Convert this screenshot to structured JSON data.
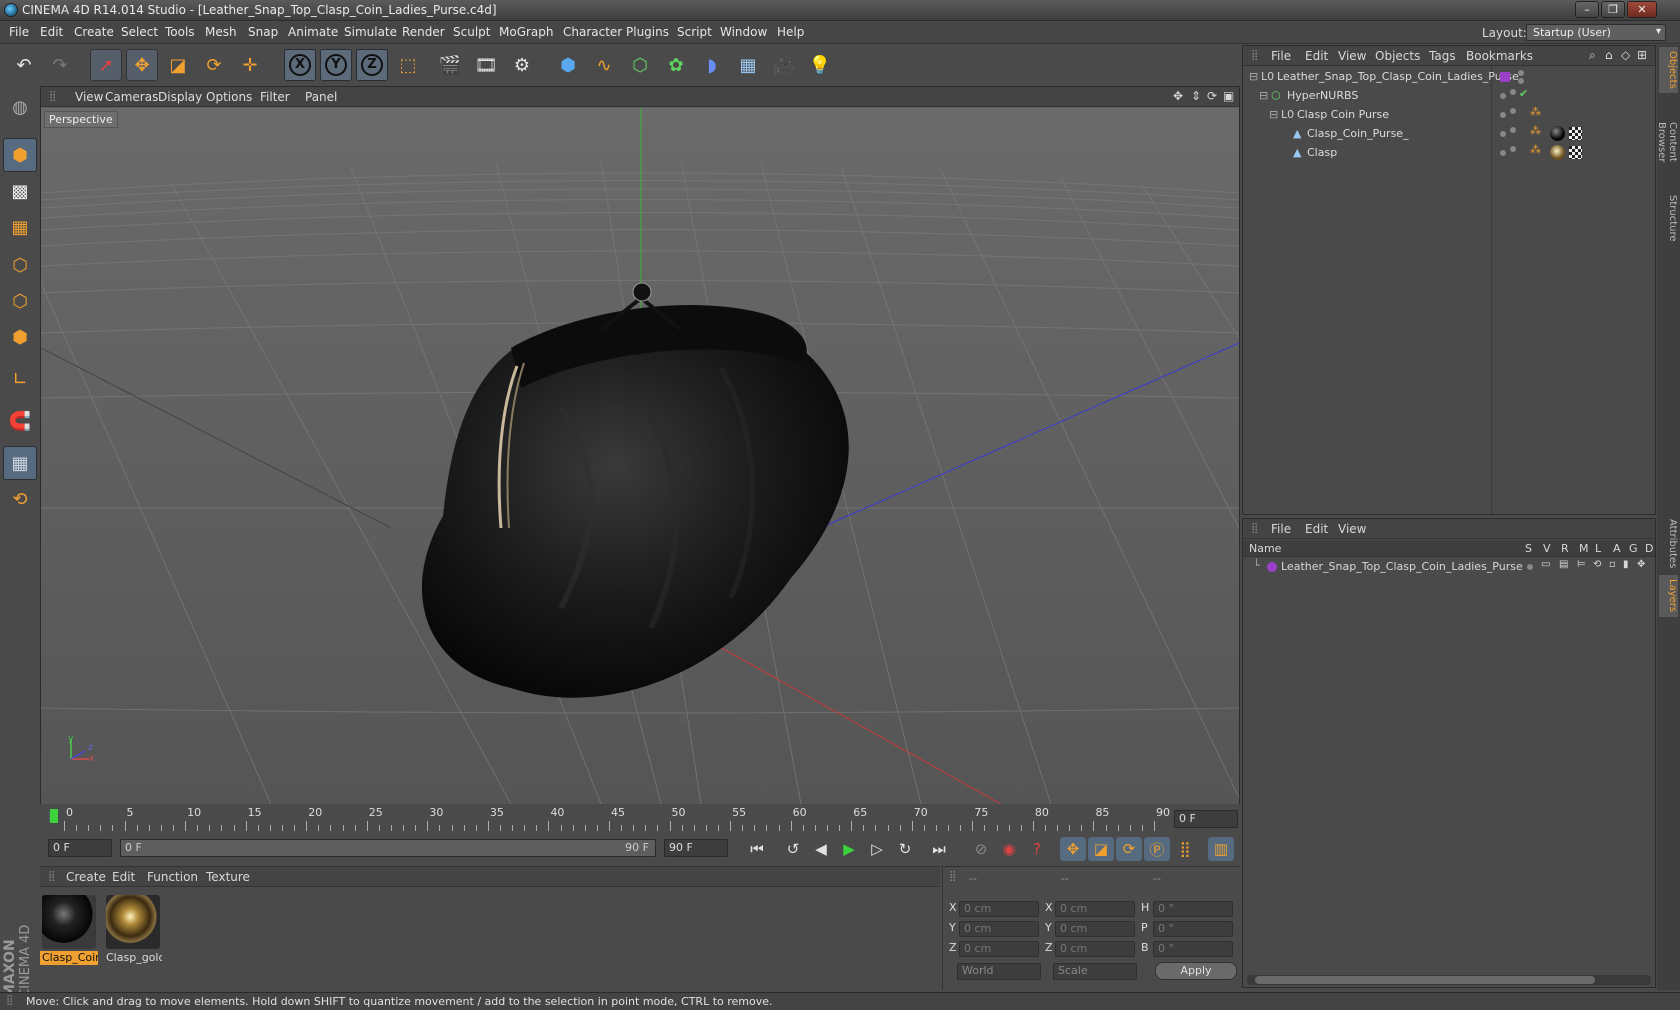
{
  "window": {
    "title": "CINEMA 4D R14.014 Studio - [Leather_Snap_Top_Clasp_Coin_Ladies_Purse.c4d]",
    "min": "–",
    "max": "❐",
    "close": "✕"
  },
  "menu": [
    "File",
    "Edit",
    "Create",
    "Select",
    "Tools",
    "Mesh",
    "Snap",
    "Animate",
    "Simulate",
    "Render",
    "Sculpt",
    "MoGraph",
    "Character",
    "Plugins",
    "Script",
    "Window",
    "Help"
  ],
  "layout": {
    "label": "Layout:",
    "value": "Startup (User)"
  },
  "toolbar": {
    "x": "X",
    "y": "Y",
    "z": "Z"
  },
  "viewport": {
    "menu": [
      "View",
      "Cameras",
      "Display",
      "Options",
      "Filter",
      "Panel"
    ],
    "label": "Perspective",
    "axis_y": "y",
    "axis_x": "x",
    "axis_z": "z"
  },
  "timeline": {
    "ticks": [
      "0",
      "5",
      "10",
      "15",
      "20",
      "25",
      "30",
      "35",
      "40",
      "45",
      "50",
      "55",
      "60",
      "65",
      "70",
      "75",
      "80",
      "85",
      "90"
    ],
    "current_frame": "0 F",
    "start_frame": "0 F",
    "range_start": "0 F",
    "range_end": "90 F",
    "end_frame": "90 F"
  },
  "materials": {
    "menu": [
      "Create",
      "Edit",
      "Function",
      "Texture"
    ],
    "items": [
      {
        "name": "Clasp_Coin"
      },
      {
        "name": "Clasp_gold"
      }
    ]
  },
  "coordinates": {
    "headers": [
      "--",
      "--",
      "--"
    ],
    "rows": [
      {
        "l1": "X",
        "v1": "0 cm",
        "l2": "X",
        "v2": "0 cm",
        "l3": "H",
        "v3": "0 °"
      },
      {
        "l1": "Y",
        "v1": "0 cm",
        "l2": "Y",
        "v2": "0 cm",
        "l3": "P",
        "v3": "0 °"
      },
      {
        "l1": "Z",
        "v1": "0 cm",
        "l2": "Z",
        "v2": "0 cm",
        "l3": "B",
        "v3": "0 °"
      }
    ],
    "mode1": "World",
    "mode2": "Scale",
    "apply": "Apply"
  },
  "objects": {
    "menu": [
      "File",
      "Edit",
      "View",
      "Objects",
      "Tags",
      "Bookmarks"
    ],
    "items": [
      {
        "name": "Leather_Snap_Top_Clasp_Coin_Ladies_Purse"
      },
      {
        "name": "HyperNURBS"
      },
      {
        "name": "Clasp Coin Purse"
      },
      {
        "name": "Clasp_Coin_Purse_"
      },
      {
        "name": "Clasp"
      }
    ]
  },
  "layers": {
    "menu": [
      "File",
      "Edit",
      "View"
    ],
    "col_name": "Name",
    "cols": [
      "S",
      "V",
      "R",
      "M",
      "L",
      "A",
      "G",
      "D"
    ],
    "item": "Leather_Snap_Top_Clasp_Coin_Ladies_Purse"
  },
  "right_tabs": [
    "Objects",
    "Content Browser",
    "Structure",
    "Attributes",
    "Layers"
  ],
  "brand": {
    "line1": "MAXON",
    "line2": "CINEMA 4D"
  },
  "status": "Move: Click and drag to move elements. Hold down SHIFT to quantize movement / add to the selection in point mode, CTRL to remove.",
  "colors": {
    "accent": "#f0a030",
    "selection": "#566a80",
    "purple": "#9a40c8",
    "green": "#5fd35f"
  }
}
